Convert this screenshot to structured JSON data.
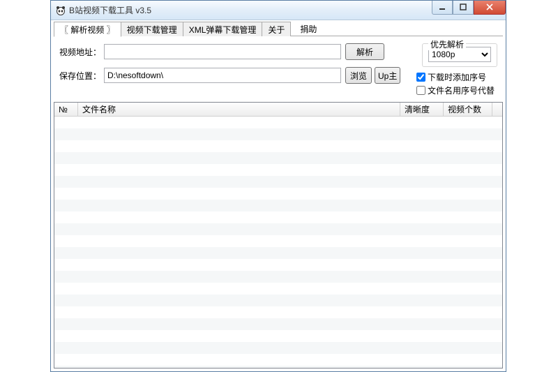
{
  "window": {
    "title": "B站视频下载工具 v3.5"
  },
  "tabs": [
    {
      "label": "〖 解析视频 〗",
      "active": true
    },
    {
      "label": "视频下载管理",
      "active": false
    },
    {
      "label": "XML弹幕下载管理",
      "active": false
    },
    {
      "label": "关于",
      "active": false
    }
  ],
  "extra_btn": "捐助",
  "form": {
    "url_label": "视频地址：",
    "url_value": "",
    "parse_btn": "解析",
    "save_label": "保存位置：",
    "save_value": "D:\\nesoftdown\\",
    "browse_btn": "浏览",
    "up_btn": "Up主"
  },
  "priority": {
    "legend": "优先解析",
    "selected": "1080p"
  },
  "options": {
    "add_seq_checked": true,
    "add_seq_label": "下载时添加序号",
    "use_seq_name_checked": false,
    "use_seq_name_label": "文件名用序号代替"
  },
  "columns": {
    "num": "№",
    "filename": "文件名称",
    "clarity": "清晰度",
    "count": "视频个数"
  }
}
